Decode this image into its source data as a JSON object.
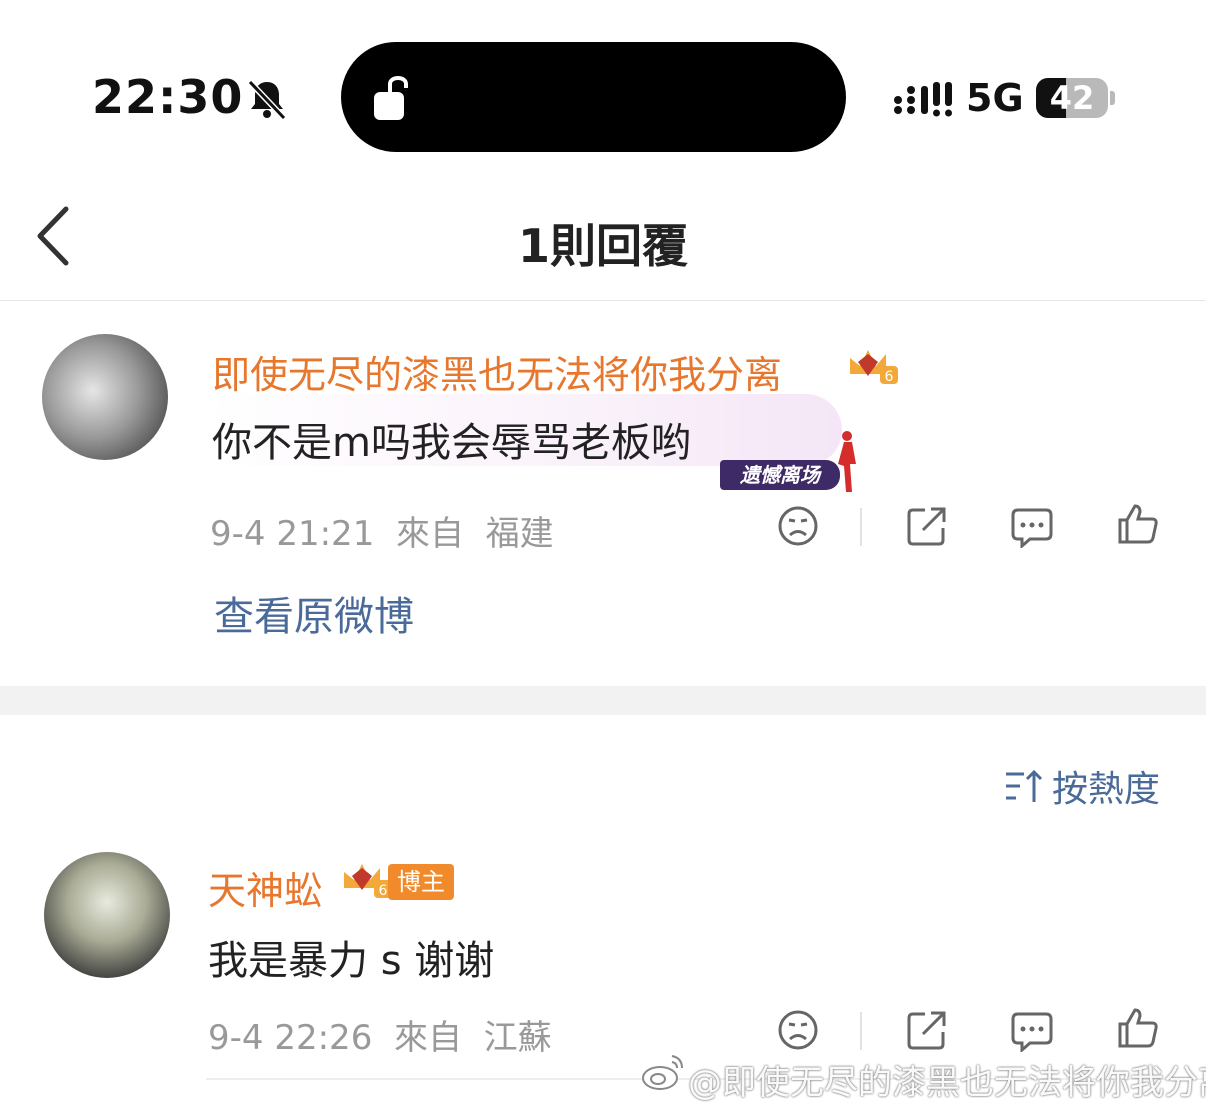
{
  "status_bar": {
    "time": "22:30",
    "network": "5G",
    "battery": "42",
    "battery_level": 0.42
  },
  "nav": {
    "title": "1則回覆"
  },
  "root_comment": {
    "username": "即使无尽的漆黑也无法将你我分离",
    "text": "你不是m吗我会辱骂老板哟",
    "bubble_tag": "遗憾离场",
    "date": "9-4 21:21",
    "source_prefix": "來自",
    "location": "福建",
    "view_original": "查看原微博"
  },
  "sort": {
    "label": "按熱度"
  },
  "replies": [
    {
      "username": "天神蚣",
      "badge": "博主",
      "text": "我是暴力 s 谢谢",
      "date": "9-4 22:26",
      "source_prefix": "來自",
      "location": "江蘇"
    }
  ],
  "watermark": "@即使无尽的漆黑也无法将你我分离",
  "colors": {
    "username": "#e8772e",
    "link": "#4a6b99",
    "meta": "#999999"
  },
  "icons": [
    "bell-slash-icon",
    "lock-open-icon",
    "signal-icon",
    "back-chevron-icon",
    "vip-crown-icon",
    "sad-face-icon",
    "share-icon",
    "comment-icon",
    "like-icon",
    "sort-icon",
    "weibo-logo-icon"
  ]
}
